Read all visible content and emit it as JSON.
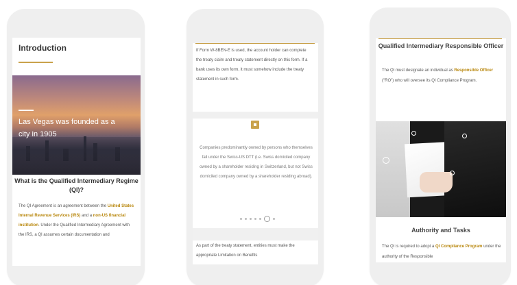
{
  "phone1": {
    "title": "Introduction",
    "caption": "Las Vegas was founded as a city in 1905",
    "heading": "What is the Qualified Intermediary Regime (QI)?",
    "para": {
      "t1": "The QI Agreement is an agreement between the ",
      "h1": "United States Internal Revenue Services (IRS)",
      "t2": " and a ",
      "h2": "non-US financial institution",
      "t3": ". Under the Qualified Intermediary Agreement with the IRS, a QI assumes certain documentation and"
    },
    "colors": {
      "accent": "#c9a24b",
      "link": "#b8860b"
    }
  },
  "phone2": {
    "para_top": "If Form W-8BEN-E is used, the account holder can complete the treaty claim and treaty statement directly on this form. If a bank uses its own form, it must somehow include the treaty statement in such form.",
    "quote": "Companies predominantly owned by persons who themselves fall under the Swiss-US DTT (i.e. Swiss domiciled company owned by a shareholder residing in Switzerland, but not Swiss domiciled company owned by a shareholder residing abroad).",
    "pager_active": "7",
    "para_bottom": "As part of the treaty statement, entities must make the appropriate Limitation on Benefits"
  },
  "phone3": {
    "heading": "Qualified Intermediary Responsible Officer",
    "para": {
      "t1": "The QI must designate an individual as ",
      "h1": "Responsible Officer",
      "t2": " (\"RO\") who will oversee its QI Compliance Program."
    },
    "subheading": "Authority and Tasks",
    "para2": {
      "t1": "The QI is required to adopt a ",
      "h1": "QI Compliance Program",
      "t2": " under the authority of the Responsible"
    }
  }
}
